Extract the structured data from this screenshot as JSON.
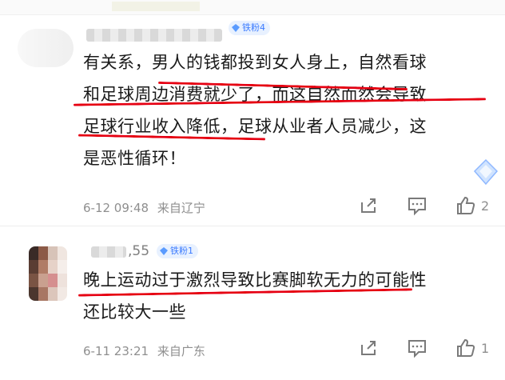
{
  "comments": [
    {
      "badge": "铁粉4",
      "text_lines": [
        "有关系，男人的钱都投到女人身上，自然看球",
        "和足球周边消费就少了，而这自然而然会导致",
        "足球行业收入降低，足球从业者人员减少，这",
        "是恶性循环！"
      ],
      "date": "6-12 09:48",
      "location": "来自辽宁",
      "likes": "2"
    },
    {
      "name_visible": ",55",
      "badge": "铁粉1",
      "text_lines": [
        "晚上运动过于激烈导致比赛脚软无力的可能性",
        "还比较大一些"
      ],
      "date": "6-11 23:21",
      "location": "来自广东",
      "likes": "1"
    }
  ],
  "colors": {
    "underline": "#e60012",
    "badge_bg": "#e8f1ff",
    "badge_text": "#3b7bff",
    "meta": "#8f8f8f"
  },
  "icons": [
    "share-icon",
    "comment-icon",
    "like-icon",
    "diamond-badge-icon"
  ]
}
